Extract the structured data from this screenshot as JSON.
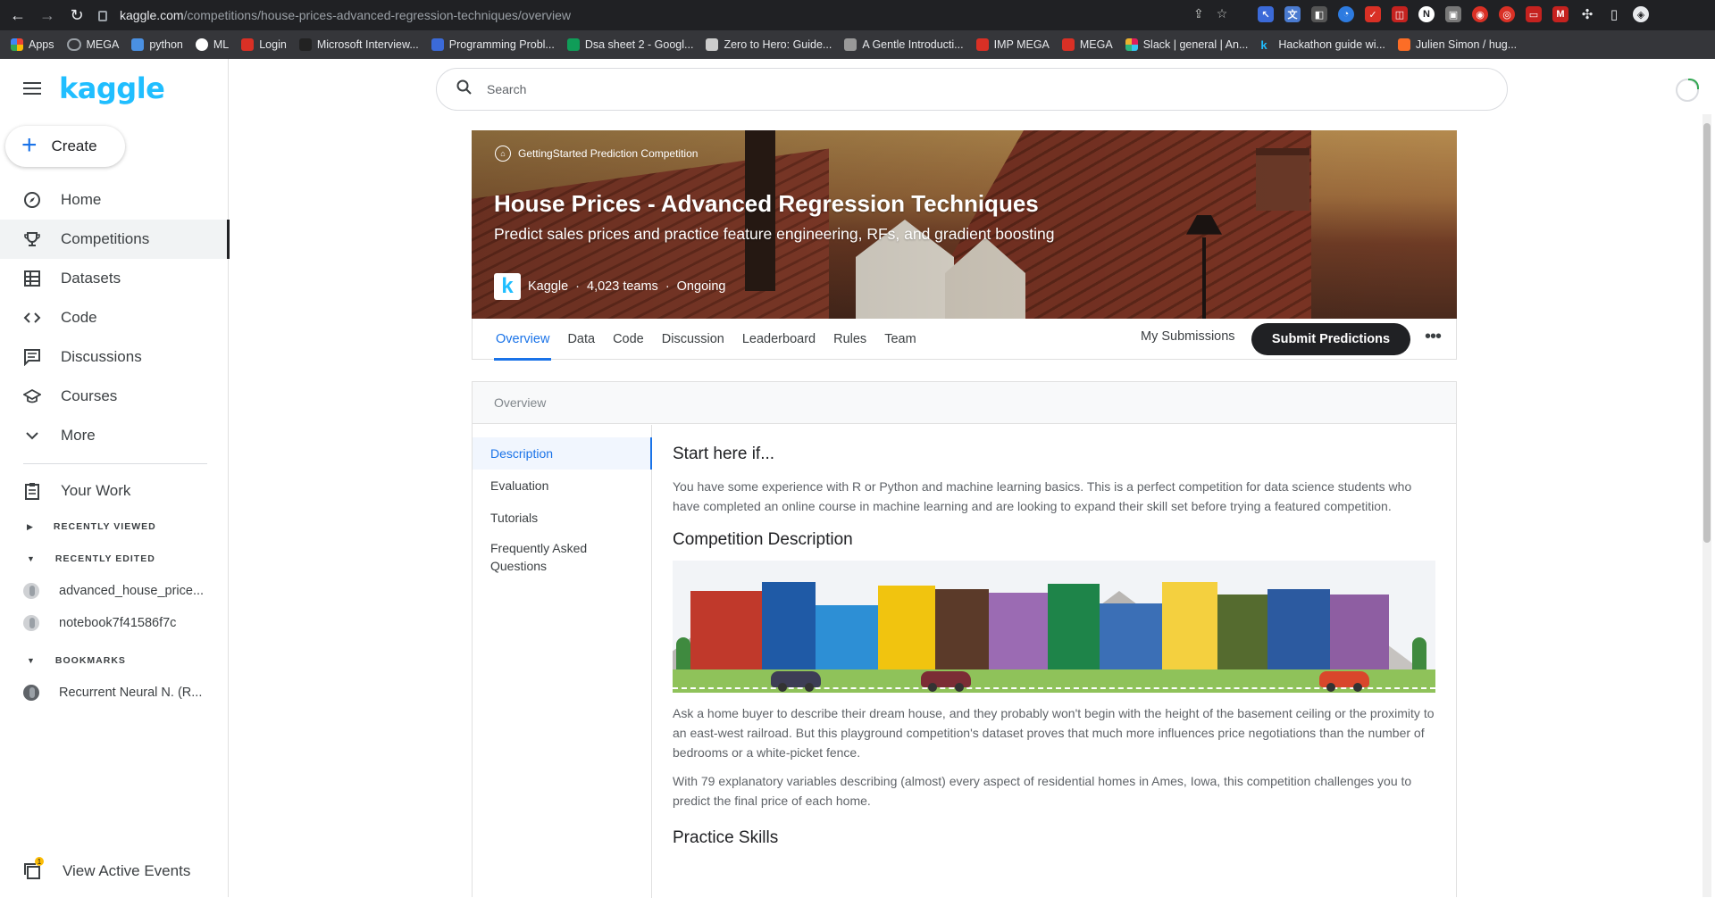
{
  "browser": {
    "url_host": "kaggle.com",
    "url_path": "/competitions/house-prices-advanced-regression-techniques/overview",
    "bookmarks": [
      "Apps",
      "MEGA",
      "python",
      "ML",
      "Login",
      "Microsoft Interview...",
      "Programming Probl...",
      "Dsa sheet 2 - Googl...",
      "Zero to Hero: Guide...",
      "A Gentle Introducti...",
      "IMP MEGA",
      "MEGA",
      "Slack | general | An...",
      "Hackathon guide wi...",
      "Julien Simon / hug..."
    ]
  },
  "sidebar": {
    "logo": "kaggle",
    "create_label": "Create",
    "nav": [
      "Home",
      "Competitions",
      "Datasets",
      "Code",
      "Discussions",
      "Courses",
      "More"
    ],
    "your_work": "Your Work",
    "recently_viewed": "RECENTLY VIEWED",
    "recently_edited": "RECENTLY EDITED",
    "edited_items": [
      "advanced_house_price...",
      "notebook7f41586f7c"
    ],
    "bookmarks_hdr": "BOOKMARKS",
    "bookmark_items": [
      "Recurrent Neural N. (R..."
    ],
    "events": "View Active Events",
    "events_badge": "1"
  },
  "search": {
    "placeholder": "Search"
  },
  "hero": {
    "tag": "GettingStarted Prediction Competition",
    "title": "House Prices - Advanced Regression Techniques",
    "subtitle": "Predict sales prices and practice feature engineering, RFs, and gradient boosting",
    "host": "Kaggle",
    "teams": "4,023 teams",
    "status": "Ongoing",
    "sep": "·"
  },
  "tabs": [
    "Overview",
    "Data",
    "Code",
    "Discussion",
    "Leaderboard",
    "Rules",
    "Team"
  ],
  "actions": {
    "my_submissions": "My Submissions",
    "submit": "Submit Predictions",
    "more": "•••"
  },
  "overview": {
    "header": "Overview",
    "toc": [
      "Description",
      "Evaluation",
      "Tutorials",
      "Frequently Asked Questions"
    ],
    "h_start": "Start here if...",
    "p_start": "You have some experience with R or Python and machine learning basics. This is a perfect competition for data science students who have completed an online course in machine learning and are looking to expand their skill set before trying a featured competition.",
    "h_desc": "Competition Description",
    "p_desc1": "Ask a home buyer to describe their dream house, and they probably won't begin with the height of the basement ceiling or the proximity to an east-west railroad. But this playground competition's dataset proves that much more influences price negotiations than the number of bedrooms or a white-picket fence.",
    "p_desc2": "With 79 explanatory variables describing (almost) every aspect of residential homes in Ames, Iowa, this competition challenges you to predict the final price of each home.",
    "h_skills": "Practice Skills"
  },
  "colors": {
    "accent": "#1a73e8",
    "kaggle_blue": "#20beff",
    "dark": "#202124"
  }
}
